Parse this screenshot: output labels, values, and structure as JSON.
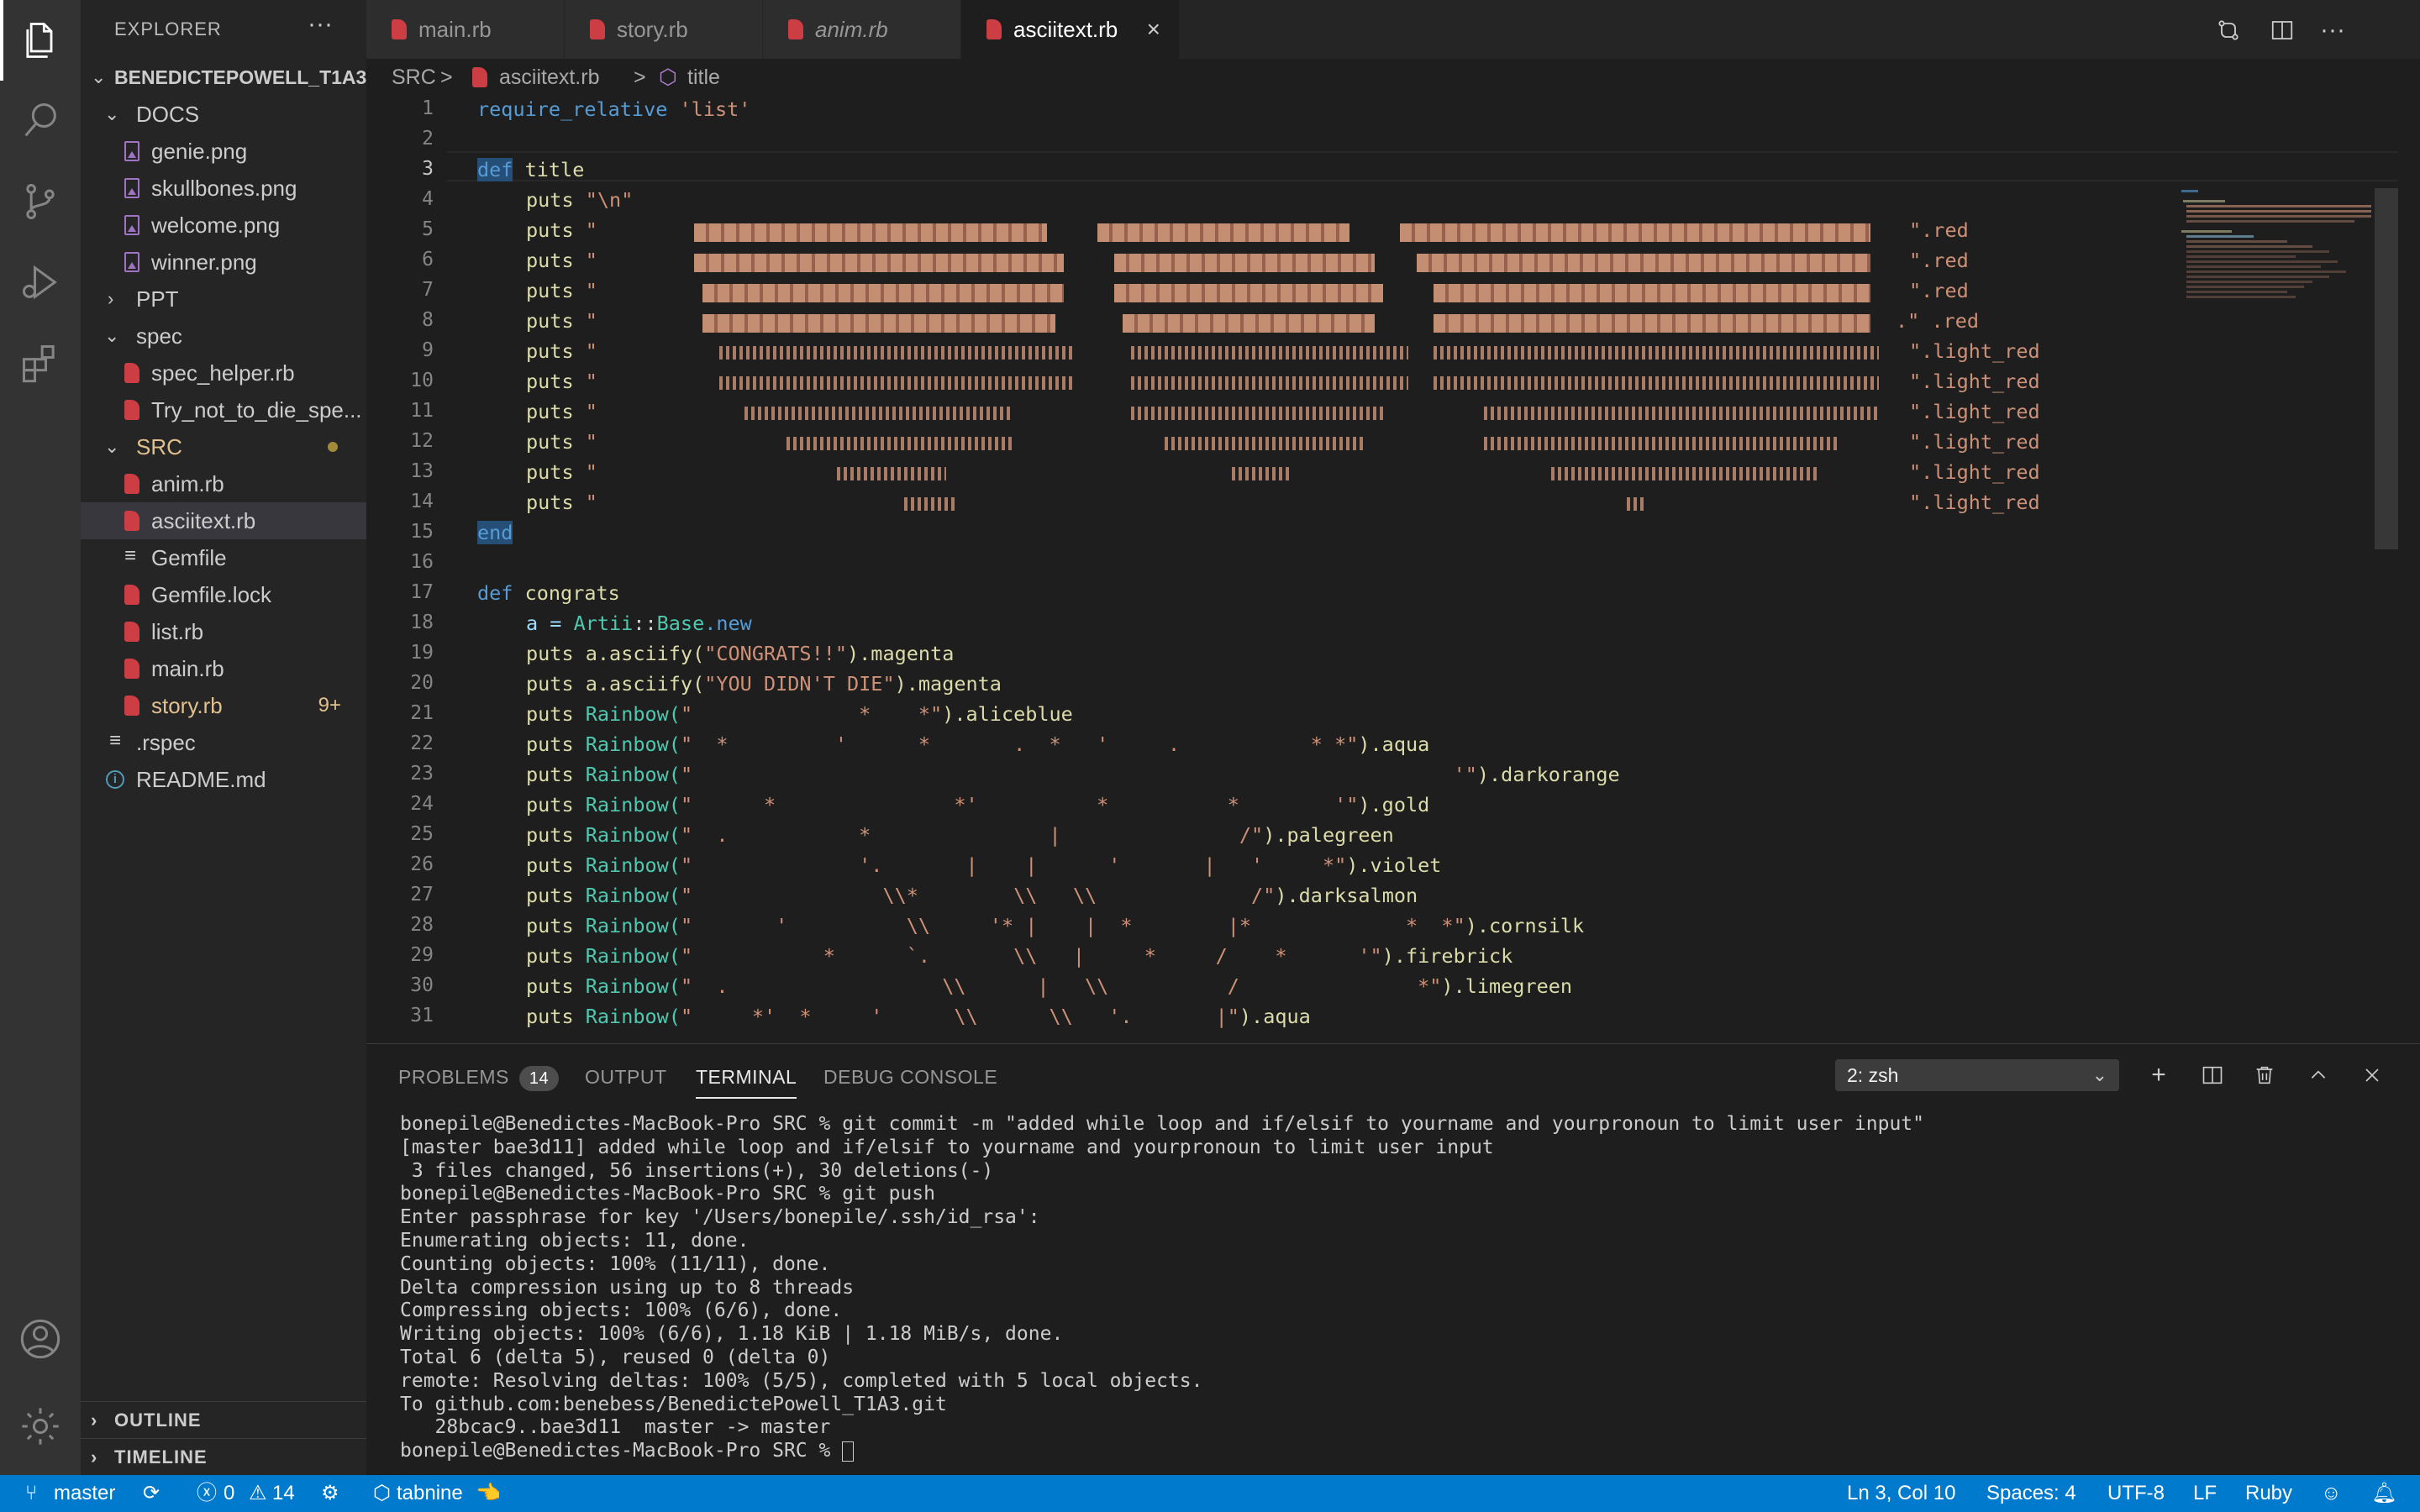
{
  "activity_bar": {
    "items": [
      "explorer-icon",
      "search-icon",
      "source-control-icon",
      "run-debug-icon",
      "extensions-icon"
    ],
    "bottom": [
      "account-icon",
      "manage-gear-icon"
    ]
  },
  "sidebar": {
    "title": "EXPLORER",
    "more": "···",
    "root": "BENEDICTEPOWELL_T1A3",
    "tree": [
      {
        "label": "DOCS",
        "kind": "folder-open"
      },
      {
        "label": "genie.png",
        "kind": "png"
      },
      {
        "label": "skullbones.png",
        "kind": "png"
      },
      {
        "label": "welcome.png",
        "kind": "png"
      },
      {
        "label": "winner.png",
        "kind": "png"
      },
      {
        "label": "PPT",
        "kind": "folder-closed"
      },
      {
        "label": "spec",
        "kind": "folder-open"
      },
      {
        "label": "spec_helper.rb",
        "kind": "ruby"
      },
      {
        "label": "Try_not_to_die_spe...",
        "kind": "ruby"
      },
      {
        "label": "SRC",
        "kind": "folder-open-modified"
      },
      {
        "label": "anim.rb",
        "kind": "ruby"
      },
      {
        "label": "asciitext.rb",
        "kind": "ruby-selected"
      },
      {
        "label": "Gemfile",
        "kind": "lines"
      },
      {
        "label": "Gemfile.lock",
        "kind": "ruby"
      },
      {
        "label": "list.rb",
        "kind": "ruby"
      },
      {
        "label": "main.rb",
        "kind": "ruby"
      },
      {
        "label": "story.rb",
        "kind": "ruby-modified",
        "badge": "9+"
      },
      {
        "label": ".rspec",
        "kind": "lines-root"
      },
      {
        "label": "README.md",
        "kind": "info-root"
      }
    ],
    "outline": "OUTLINE",
    "timeline": "TIMELINE"
  },
  "tabs": [
    {
      "label": "main.rb"
    },
    {
      "label": "story.rb"
    },
    {
      "label": "anim.rb"
    },
    {
      "label": "asciitext.rb",
      "close": "×"
    }
  ],
  "breadcrumb": {
    "folder": "SRC",
    "sep": ">",
    "file": "asciitext.rb",
    "symbol": "title"
  },
  "editor": {
    "line_numbers": [
      "1",
      "2",
      "3",
      "4",
      "5",
      "6",
      "7",
      "8",
      "9",
      "10",
      "11",
      "12",
      "13",
      "14",
      "15",
      "16",
      "17",
      "18",
      "19",
      "20",
      "21",
      "22",
      "23",
      "24",
      "25",
      "26",
      "27",
      "28",
      "29",
      "30",
      "31"
    ],
    "current_line": "3",
    "lines": {
      "l1_kw": "require_relative",
      "l1_str": "'list'",
      "l3_kw": "def",
      "l3_fn": "title",
      "l4": "puts \"\\n\"",
      "puts": "puts",
      "quote": "\"",
      "red": "\".red",
      "red_dot": ".\" .red",
      "light_red": "\".light_red",
      "l15": "end",
      "l17_kw": "def",
      "l17_fn": "congrats",
      "l18_a": "a = ",
      "l18_cls": "Artii",
      "l18_sep": "::",
      "l18_base": "Base",
      "l18_new": ".new",
      "l19_fn": "a.asciify(",
      "l19_str": "\"CONGRATS!!\"",
      "l19_end": ").magenta",
      "l20_fn": "a.asciify(",
      "l20_str": "\"YOU DIDN'T DIE\"",
      "l20_end": ").magenta",
      "rainbow": "Rainbow(",
      "r21": "\"              *    *\"",
      "r21_end": ").aliceblue",
      "r22": "\"  *         '      *       .  *   '     .           * *\"",
      "r22_end": ").aqua",
      "r23": "\"                                                                '\"",
      "r23_end": ").darkorange",
      "r24": "\"      *               *'          *          *        '\"",
      "r24_end": ").gold",
      "r25": "\"  .           *               |               /\"",
      "r25_end": ").palegreen",
      "r26": "\"              '.       |    |      '       |   '     *\"",
      "r26_end": ").violet",
      "r27": "\"                \\\\*        \\\\   \\\\             /\"",
      "r27_end": ").darksalmon",
      "r28": "\"       '          \\\\     '* |    |  *        |*             *  *\"",
      "r28_end": ").cornsilk",
      "r29": "\"           *      `.       \\\\   |     *     /    *      '\"",
      "r29_end": ").firebrick",
      "r30": "\"  .                  \\\\      |   \\\\          /               *\"",
      "r30_end": ").limegreen",
      "r31": "\"     *'  *     '      \\\\      \\\\   '.       |\"",
      "r31_end": ").aqua"
    }
  },
  "panel": {
    "tabs": [
      {
        "label": "PROBLEMS",
        "count": "14"
      },
      {
        "label": "OUTPUT"
      },
      {
        "label": "TERMINAL"
      },
      {
        "label": "DEBUG CONSOLE"
      }
    ],
    "terminal_select": "2: zsh",
    "terminal_lines": [
      "bonepile@Benedictes-MacBook-Pro SRC % git commit -m \"added while loop and if/elsif to yourname and yourpronoun to limit user input\"",
      "[master bae3d11] added while loop and if/elsif to yourname and yourpronoun to limit user input",
      " 3 files changed, 56 insertions(+), 30 deletions(-)",
      "bonepile@Benedictes-MacBook-Pro SRC % git push",
      "Enter passphrase for key '/Users/bonepile/.ssh/id_rsa':",
      "Enumerating objects: 11, done.",
      "Counting objects: 100% (11/11), done.",
      "Delta compression using up to 8 threads",
      "Compressing objects: 100% (6/6), done.",
      "Writing objects: 100% (6/6), 1.18 KiB | 1.18 MiB/s, done.",
      "Total 6 (delta 5), reused 0 (delta 0)",
      "remote: Resolving deltas: 100% (5/5), completed with 5 local objects.",
      "To github.com:benebess/BenedictePowell_T1A3.git",
      "   28bcac9..bae3d11  master -> master"
    ],
    "prompt": "bonepile@Benedictes-MacBook-Pro SRC % "
  },
  "status_bar": {
    "branch": "master",
    "errors": "0",
    "warnings": "14",
    "tabnine": "tabnine",
    "position": "Ln 3, Col 10",
    "spaces": "Spaces: 4",
    "encoding": "UTF-8",
    "eol": "LF",
    "language": "Ruby"
  },
  "colors": {
    "status_bar": "#007acc",
    "activity_bar": "#333333",
    "sidebar": "#252526",
    "editor": "#1e1e1e",
    "ruby_icon": "#cc3e44",
    "modified": "#e2c08d"
  }
}
